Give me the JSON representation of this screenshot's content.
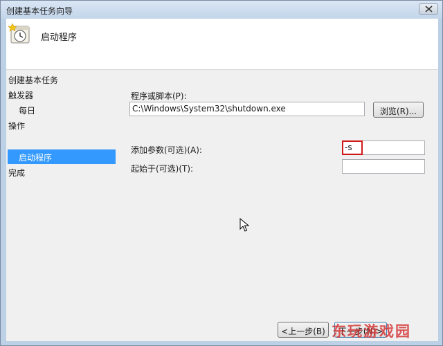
{
  "window": {
    "title": "创建基本任务向导"
  },
  "header": {
    "title": "启动程序"
  },
  "steps": {
    "heading": "创建基本任务",
    "trigger": "触发器",
    "daily": "每日",
    "action": "操作",
    "start_program": "启动程序",
    "finish": "完成"
  },
  "form": {
    "program_label": "程序或脚本(P):",
    "program_value": "C:\\Windows\\System32\\shutdown.exe",
    "browse_label": "浏览(R)...",
    "args_label": "添加参数(可选)(A):",
    "args_value": "-s",
    "start_in_label": "起始于(可选)(T):",
    "start_in_value": ""
  },
  "buttons": {
    "back": "<上一步(B)",
    "next": "下一步(N)>"
  },
  "watermark": {
    "text": "东玩游戏园"
  },
  "colors": {
    "selection": "#3399ff",
    "highlight_border": "#d01818"
  }
}
